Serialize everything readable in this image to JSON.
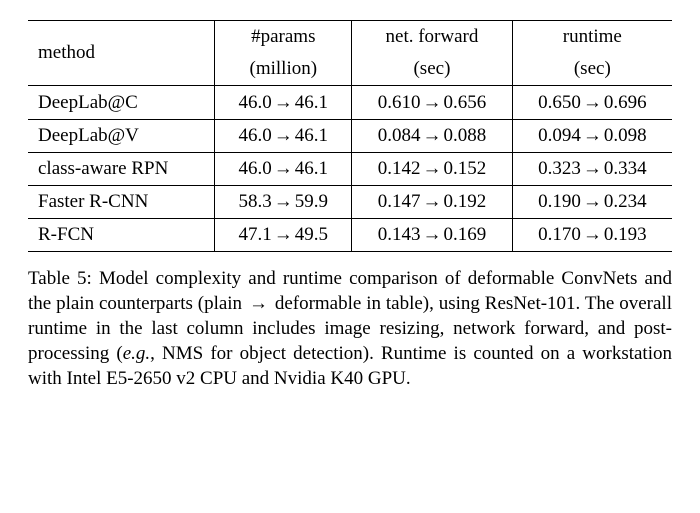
{
  "table": {
    "headers": {
      "method": "method",
      "params_top": "#params",
      "params_bottom": "(million)",
      "forward_top": "net. forward",
      "forward_bottom": "(sec)",
      "runtime_top": "runtime",
      "runtime_bottom": "(sec)"
    },
    "rows": [
      {
        "method": "DeepLab@C",
        "params_from": "46.0",
        "params_to": "46.1",
        "forward_from": "0.610",
        "forward_to": "0.656",
        "runtime_from": "0.650",
        "runtime_to": "0.696"
      },
      {
        "method": "DeepLab@V",
        "params_from": "46.0",
        "params_to": "46.1",
        "forward_from": "0.084",
        "forward_to": "0.088",
        "runtime_from": "0.094",
        "runtime_to": "0.098"
      },
      {
        "method": "class-aware RPN",
        "params_from": "46.0",
        "params_to": "46.1",
        "forward_from": "0.142",
        "forward_to": "0.152",
        "runtime_from": "0.323",
        "runtime_to": "0.334"
      },
      {
        "method": "Faster R-CNN",
        "params_from": "58.3",
        "params_to": "59.9",
        "forward_from": "0.147",
        "forward_to": "0.192",
        "runtime_from": "0.190",
        "runtime_to": "0.234"
      },
      {
        "method": "R-FCN",
        "params_from": "47.1",
        "params_to": "49.5",
        "forward_from": "0.143",
        "forward_to": "0.169",
        "runtime_from": "0.170",
        "runtime_to": "0.193"
      }
    ]
  },
  "arrow": "→",
  "caption": {
    "label": "Table 5: ",
    "text_1": "Model complexity and runtime comparison of deformable ConvNets and the plain counterparts (plain ",
    "text_2": " deformable in table), using ResNet-101. The overall runtime in the last column includes image resizing, network forward, and post-processing (",
    "eg": "e.g.",
    "text_3": ", NMS for object detection). Runtime is counted on a workstation with Intel E5-2650 v2 CPU and Nvidia K40 GPU."
  },
  "chart_data": {
    "type": "table",
    "title": "Table 5: Model complexity and runtime comparison of deformable ConvNets and the plain counterparts (plain → deformable), using ResNet-101",
    "columns": [
      "method",
      "#params (million) plain",
      "#params (million) deformable",
      "net. forward (sec) plain",
      "net. forward (sec) deformable",
      "runtime (sec) plain",
      "runtime (sec) deformable"
    ],
    "rows": [
      [
        "DeepLab@C",
        46.0,
        46.1,
        0.61,
        0.656,
        0.65,
        0.696
      ],
      [
        "DeepLab@V",
        46.0,
        46.1,
        0.084,
        0.088,
        0.094,
        0.098
      ],
      [
        "class-aware RPN",
        46.0,
        46.1,
        0.142,
        0.152,
        0.323,
        0.334
      ],
      [
        "Faster R-CNN",
        58.3,
        59.9,
        0.147,
        0.192,
        0.19,
        0.234
      ],
      [
        "R-FCN",
        47.1,
        49.5,
        0.143,
        0.169,
        0.17,
        0.193
      ]
    ]
  }
}
